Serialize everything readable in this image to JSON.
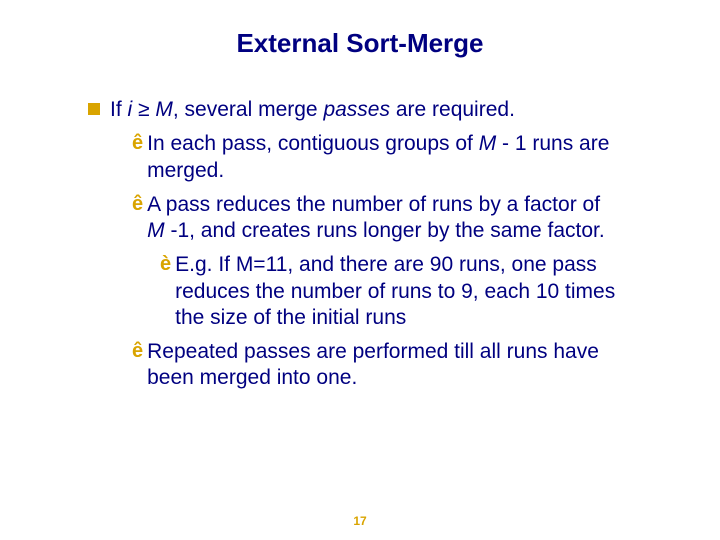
{
  "title": "External Sort-Merge",
  "bullet": {
    "prefix": "If ",
    "var_i": "i",
    "geq": " ≥ ",
    "var_M": "M",
    "tail_plain": ", several merge ",
    "tail_italic": "passes",
    "tail_end": " are required."
  },
  "sub1": {
    "before_M": "In each pass, contiguous groups of ",
    "M": "M",
    "after_M": " - 1 runs are merged."
  },
  "sub2": {
    "before_M": "A pass reduces the number of runs by a factor of ",
    "M": "M",
    "after_M": " -1, and creates runs longer by the same factor."
  },
  "sub2a": "E.g.  If M=11, and there are 90 runs, one pass reduces the number of runs to 9, each 10 times the size of the initial runs",
  "sub3": "Repeated passes are performed till all runs have been merged into one.",
  "page": "17"
}
